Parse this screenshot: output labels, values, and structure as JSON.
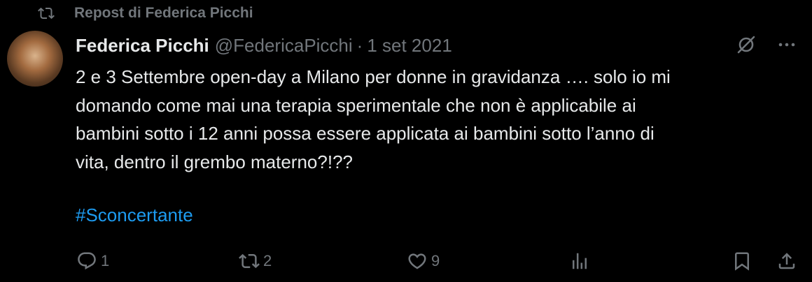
{
  "repost": {
    "label": "Repost di Federica Picchi",
    "icon": "repost-icon"
  },
  "author": {
    "name": "Federica Picchi",
    "handle": "@FedericaPicchi",
    "separator": "·",
    "date": "1 set 2021"
  },
  "header_icons": [
    "grok-icon",
    "more-icon"
  ],
  "tweet": {
    "text": "2 e 3 Settembre open-day a Milano per donne in gravidanza …. solo io mi\ndomando come mai una terapia sperimentale che non è applicabile ai\nbambini sotto i 12 anni possa essere applicata ai bambini sotto l’anno di\nvita, dentro il grembo materno?!??",
    "hashtag": "#Sconcertante"
  },
  "actions": {
    "reply": {
      "icon": "reply-icon",
      "count": "1"
    },
    "repost": {
      "icon": "repost-icon",
      "count": "2"
    },
    "like": {
      "icon": "heart-icon",
      "count": "9"
    },
    "views": {
      "icon": "views-icon"
    },
    "bookmark": {
      "icon": "bookmark-icon"
    },
    "share": {
      "icon": "share-icon"
    }
  },
  "colors": {
    "background": "#000000",
    "text": "#e7e9ea",
    "muted": "#71767b",
    "link": "#1d9bf0"
  }
}
